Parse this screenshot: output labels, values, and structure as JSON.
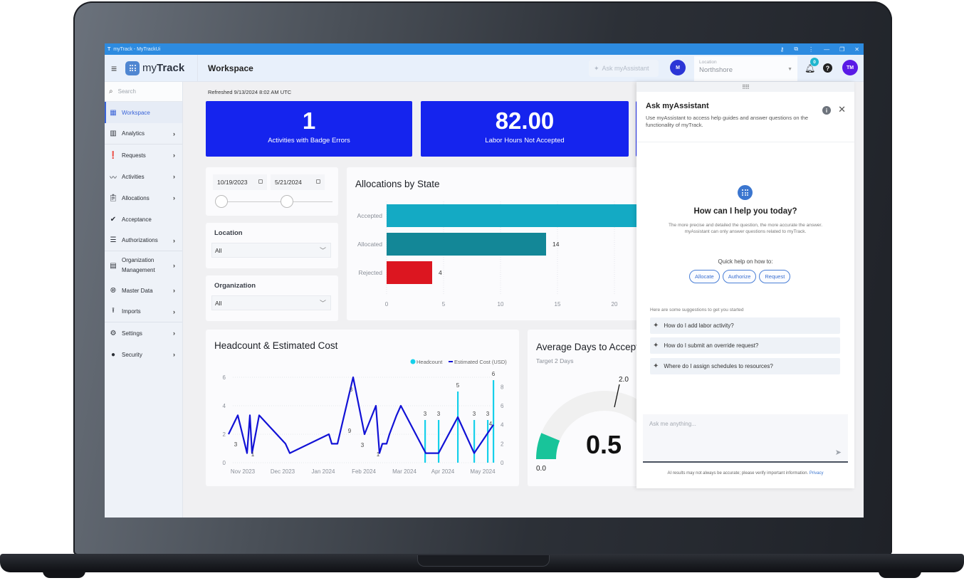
{
  "window": {
    "title": "myTrack - MyTrackUi",
    "controls": [
      "key-icon",
      "extension-icon",
      "more-icon",
      "minimize-icon",
      "restore-icon",
      "close-icon"
    ]
  },
  "appbar": {
    "brand_prefix": "my",
    "brand_bold": "Track",
    "page_title": "Workspace",
    "ask_button": "Ask myAssistant",
    "org_avatar": "M",
    "location_label": "Location",
    "location_value": "Northshore",
    "notification_count": "0",
    "help": "?",
    "user_avatar": "TM"
  },
  "sidebar": {
    "search_placeholder": "Search",
    "items": [
      {
        "label": "Workspace",
        "icon": "dashboard-icon",
        "active": true,
        "chevron": false
      },
      {
        "label": "Analytics",
        "icon": "bar-chart-icon",
        "chevron": true
      },
      {
        "label": "Requests",
        "icon": "clipboard-alert-icon",
        "chevron": true
      },
      {
        "label": "Activities",
        "icon": "trend-icon",
        "chevron": true
      },
      {
        "label": "Allocations",
        "icon": "clipboard-icon",
        "chevron": true
      },
      {
        "label": "Acceptance",
        "icon": "check-circle-icon",
        "chevron": false
      },
      {
        "label": "Authorizations",
        "icon": "checklist-icon",
        "chevron": true
      },
      {
        "label": "Organization Management",
        "icon": "building-icon",
        "chevron": true
      },
      {
        "label": "Master Data",
        "icon": "globe-icon",
        "chevron": true
      },
      {
        "label": "Imports",
        "icon": "upload-icon",
        "chevron": true
      },
      {
        "label": "Settings",
        "icon": "gear-icon",
        "chevron": true
      },
      {
        "label": "Security",
        "icon": "user-circle-icon",
        "chevron": true
      }
    ]
  },
  "dashboard": {
    "refreshed": "Refreshed 9/13/2024 8:02 AM UTC",
    "kpis": [
      {
        "value": "1",
        "label": "Activities with Badge Errors"
      },
      {
        "value": "82.00",
        "label": "Labor Hours Not Accepted"
      }
    ],
    "date_range": {
      "start": "10/19/2023",
      "end": "5/21/2024",
      "slider_start_fraction": 0.0,
      "slider_end_fraction": 0.64
    },
    "filters": [
      {
        "label": "Location",
        "value": "All"
      },
      {
        "label": "Organization",
        "value": "All"
      }
    ]
  },
  "chart_data": [
    {
      "type": "bar",
      "orientation": "horizontal",
      "title": "Allocations by State",
      "categories": [
        "Accepted",
        "Allocated",
        "Rejected"
      ],
      "values": [
        null,
        14,
        4
      ],
      "visible_min_value_accepted": 22,
      "colors": [
        "#14aac4",
        "#138797",
        "#dc1620"
      ],
      "data_labels": [
        "",
        "14",
        "4"
      ],
      "xticks": [
        0,
        5,
        10,
        15,
        20
      ],
      "xlim": [
        0,
        22
      ],
      "grid": true
    },
    {
      "type": "line",
      "title": "Headcount & Estimated Cost",
      "legend": [
        "Headcount",
        "Estimated Cost (USD)"
      ],
      "legend_position": "top-right",
      "x_ticks": [
        "Nov 2023",
        "Dec 2023",
        "Jan 2024",
        "Feb 2024",
        "Mar 2024",
        "Apr 2024",
        "May 2024"
      ],
      "left_axis": {
        "ticks": [
          0,
          2,
          4,
          6
        ],
        "ylim": [
          0,
          6
        ]
      },
      "right_axis": {
        "ticks": [
          0,
          2,
          4,
          6,
          8
        ],
        "ylim": [
          0,
          9
        ]
      },
      "series": [
        {
          "name": "Estimated Cost (USD)",
          "axis": "left",
          "color": "#1212d6",
          "x_days": [
            0,
            7,
            14,
            18,
            19,
            22,
            41,
            44,
            64,
            66,
            69,
            79,
            82,
            86,
            88,
            90,
            92,
            94,
            98,
            100,
            112,
            118,
            122,
            130,
            136
          ],
          "values": [
            2,
            3.33,
            0.67,
            3.33,
            0.67,
            3.33,
            1.33,
            0.67,
            2,
            1.33,
            1.33,
            6,
            2,
            4,
            0.67,
            1.33,
            1.33,
            2,
            3.33,
            4,
            0.67,
            0.67,
            3.2,
            0.67,
            2.67
          ]
        },
        {
          "name": "Headcount",
          "axis": "right",
          "color": "#16d0ea",
          "x_days": [
            107,
            115,
            127,
            134,
            143,
            150
          ],
          "values": [
            4.5,
            4.5,
            7.5,
            4.5,
            4.5,
            8.7
          ],
          "data_labels": [
            "3",
            "3",
            "5",
            "3",
            "3",
            "6"
          ]
        }
      ],
      "point_labels": [
        {
          "x_day": 3,
          "text": "3"
        },
        {
          "x_day": 14,
          "text": "1"
        },
        {
          "x_day": 79,
          "text": "9"
        },
        {
          "x_day": 64,
          "text": "3"
        },
        {
          "x_day": 84,
          "text": "3"
        },
        {
          "x_day": 88,
          "text": "1"
        },
        {
          "x_day": 148,
          "text": "4"
        }
      ]
    },
    {
      "type": "gauge",
      "title": "Average Days to Accept",
      "subtitle": "Target 2 Days",
      "value": 0.5,
      "value_label": "0.5",
      "min": 0,
      "min_label": "0.0",
      "target": 2.0,
      "target_label": "2.0",
      "fill_color": "#18c49a",
      "track_color": "#f0f0f0"
    }
  ],
  "assistant": {
    "title": "Ask myAssistant",
    "description": "Use myAssistant to access help guides and answer questions on the functionality of myTrack.",
    "greeting": "How can I help you today?",
    "subtext_line1": "The more precise and detailed the question, the more accurate the answer.",
    "subtext_line2": "myAssistant can only answer questions related to myTrack.",
    "quick_help_label": "Quick help on how to:",
    "quick_help": [
      "Allocate",
      "Authorize",
      "Request"
    ],
    "suggestions_label": "Here are some suggestions to get you started",
    "suggestions": [
      "How do I add labor activity?",
      "How do I submit an override request?",
      "Where do I assign schedules to resources?"
    ],
    "input_placeholder": "Ask me anything...",
    "disclaimer": "AI results may not always be accurate; please verify important information.",
    "privacy_link": "Privacy"
  }
}
